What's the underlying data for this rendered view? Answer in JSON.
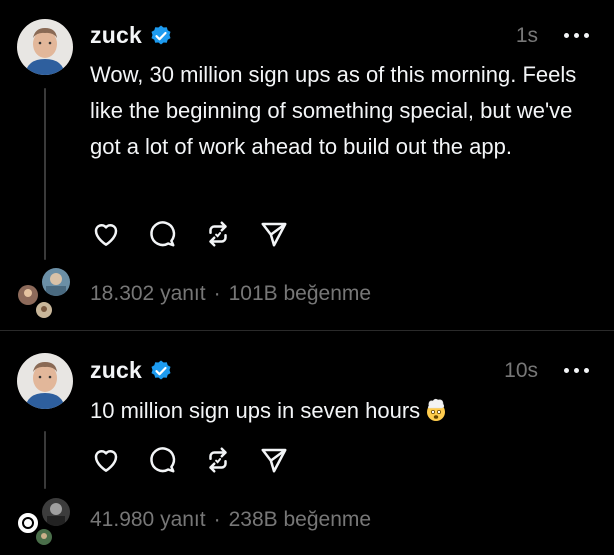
{
  "posts": [
    {
      "username": "zuck",
      "time": "1s",
      "text": "Wow, 30 million sign ups as of this morning. Feels like the beginning of something special, but we've got a lot of work ahead to build out the app.",
      "replies": "18.302 yanıt",
      "separator": "·",
      "likes": "101B beğenme"
    },
    {
      "username": "zuck",
      "time": "10s",
      "text": "10 million sign ups in seven hours",
      "emoji": "exploding-head",
      "replies": "41.980 yanıt",
      "separator": "·",
      "likes": "238B beğenme"
    }
  ],
  "icons": {
    "verified": "verified-badge-icon",
    "like": "heart-icon",
    "reply": "comment-icon",
    "repost": "repost-icon",
    "share": "send-icon",
    "more": "more-icon"
  },
  "colors": {
    "background": "#000000",
    "text": "#f3f5f7",
    "muted": "#777777",
    "verified": "#1d9bf0",
    "thread_line": "#3a3a3a"
  }
}
